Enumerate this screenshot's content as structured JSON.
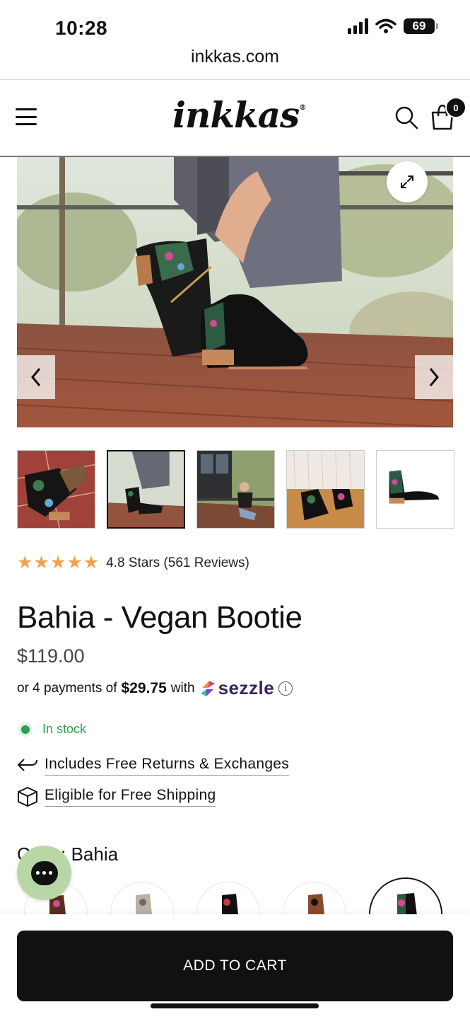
{
  "status_bar": {
    "time": "10:28",
    "battery": "69"
  },
  "browser": {
    "url": "inkkas.com"
  },
  "header": {
    "logo": "inkkas",
    "logo_mark": "®",
    "cart_count": "0"
  },
  "product": {
    "rating_stars": 4.8,
    "rating_text": "4.8 Stars (561 Reviews)",
    "title": "Bahia - Vegan Bootie",
    "price": "$119.00",
    "sezzle": {
      "prefix": "or 4 payments of",
      "amount": "$29.75",
      "suffix": "with",
      "brand": "sezzle"
    },
    "stock_status": "In stock",
    "perks": [
      "Includes Free Returns & Exchanges",
      "Eligible for Free Shipping"
    ],
    "color_label": "Color:",
    "color_value": "Bahia"
  },
  "cta": {
    "add_to_cart": "ADD TO CART"
  },
  "colors": {
    "star": "#f4a14a",
    "stock": "#2e9e4e",
    "chat": "#b9d7a6",
    "sezzle": "#392558"
  }
}
